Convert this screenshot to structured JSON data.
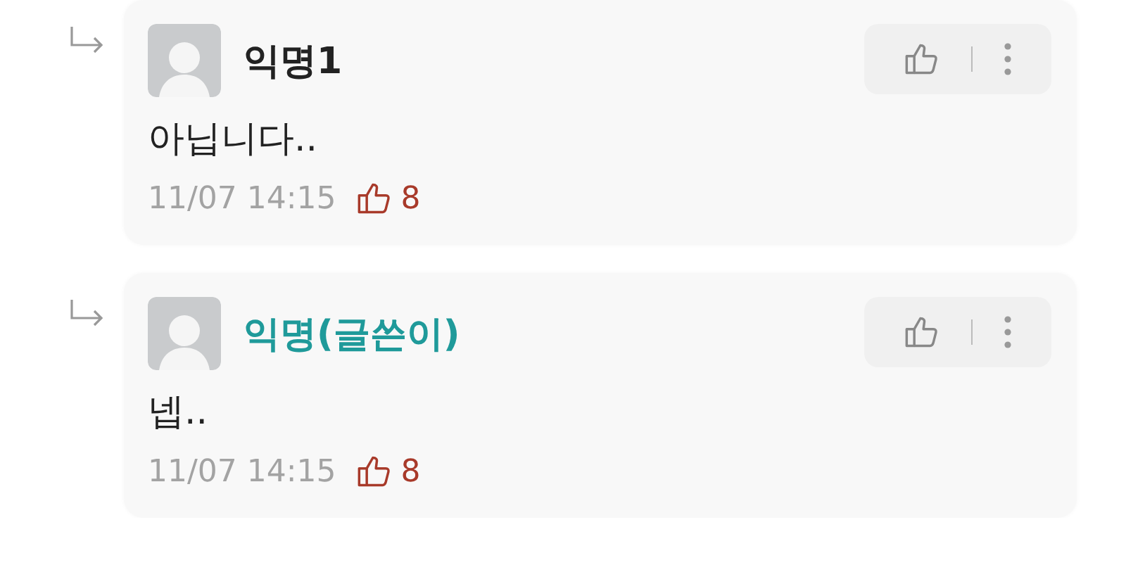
{
  "comments": [
    {
      "author": "익명1",
      "is_author": false,
      "text": "아닙니다..",
      "time": "11/07 14:15",
      "likes": "8"
    },
    {
      "author": "익명(글쓴이)",
      "is_author": true,
      "text": "넵..",
      "time": "11/07 14:15",
      "likes": "8"
    }
  ]
}
